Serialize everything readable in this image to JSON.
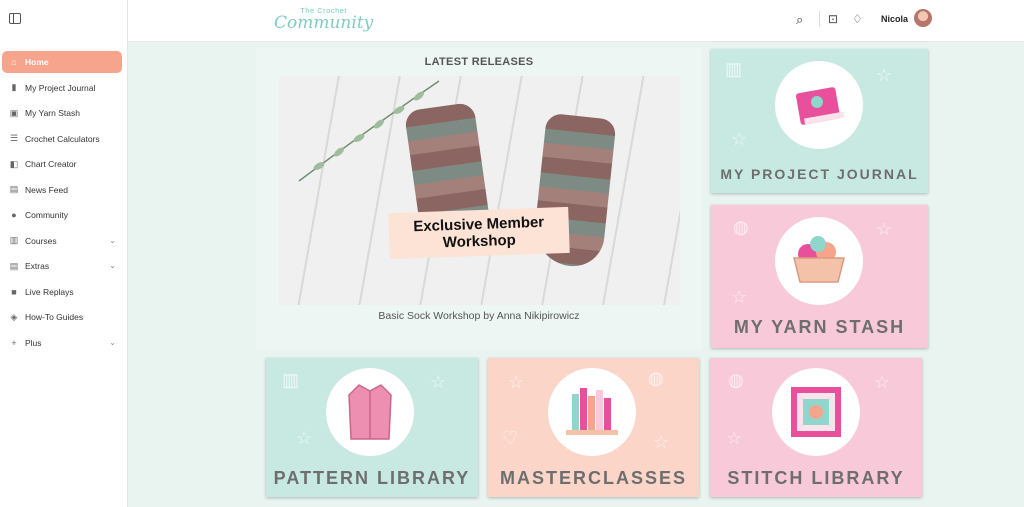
{
  "header": {
    "logo_top": "The Crochet",
    "logo_main": "Community",
    "user_name": "Nicola"
  },
  "sidebar": {
    "items": [
      {
        "label": "Home",
        "icon": "home-icon",
        "active": true
      },
      {
        "label": "My Project Journal",
        "icon": "journal-icon"
      },
      {
        "label": "My Yarn Stash",
        "icon": "stash-icon"
      },
      {
        "label": "Crochet Calculators",
        "icon": "sliders-icon"
      },
      {
        "label": "Chart Creator",
        "icon": "chart-icon"
      },
      {
        "label": "News Feed",
        "icon": "newspaper-icon"
      },
      {
        "label": "Community",
        "icon": "people-icon"
      },
      {
        "label": "Courses",
        "icon": "book-icon",
        "expandable": true
      },
      {
        "label": "Extras",
        "icon": "extras-icon",
        "expandable": true
      },
      {
        "label": "Live Replays",
        "icon": "video-icon"
      },
      {
        "label": "How-To Guides",
        "icon": "guide-icon"
      },
      {
        "label": "Plus",
        "icon": "plus-icon",
        "expandable": true
      }
    ]
  },
  "latest": {
    "title": "LATEST RELEASES",
    "banner_line1": "Exclusive Member",
    "banner_line2": "Workshop",
    "caption": "Basic Sock Workshop by Anna Nikipirowicz"
  },
  "tiles": {
    "journal": "MY PROJECT JOURNAL",
    "stash": "MY YARN STASH",
    "pattern": "PATTERN LIBRARY",
    "masterclasses": "MASTERCLASSES",
    "stitch": "STITCH LIBRARY"
  },
  "colors": {
    "accent": "#f6a58c",
    "teal": "#c7e9e2",
    "pink": "#f8c9d9",
    "peach": "#fad5c8",
    "background": "#e9f4f1"
  }
}
